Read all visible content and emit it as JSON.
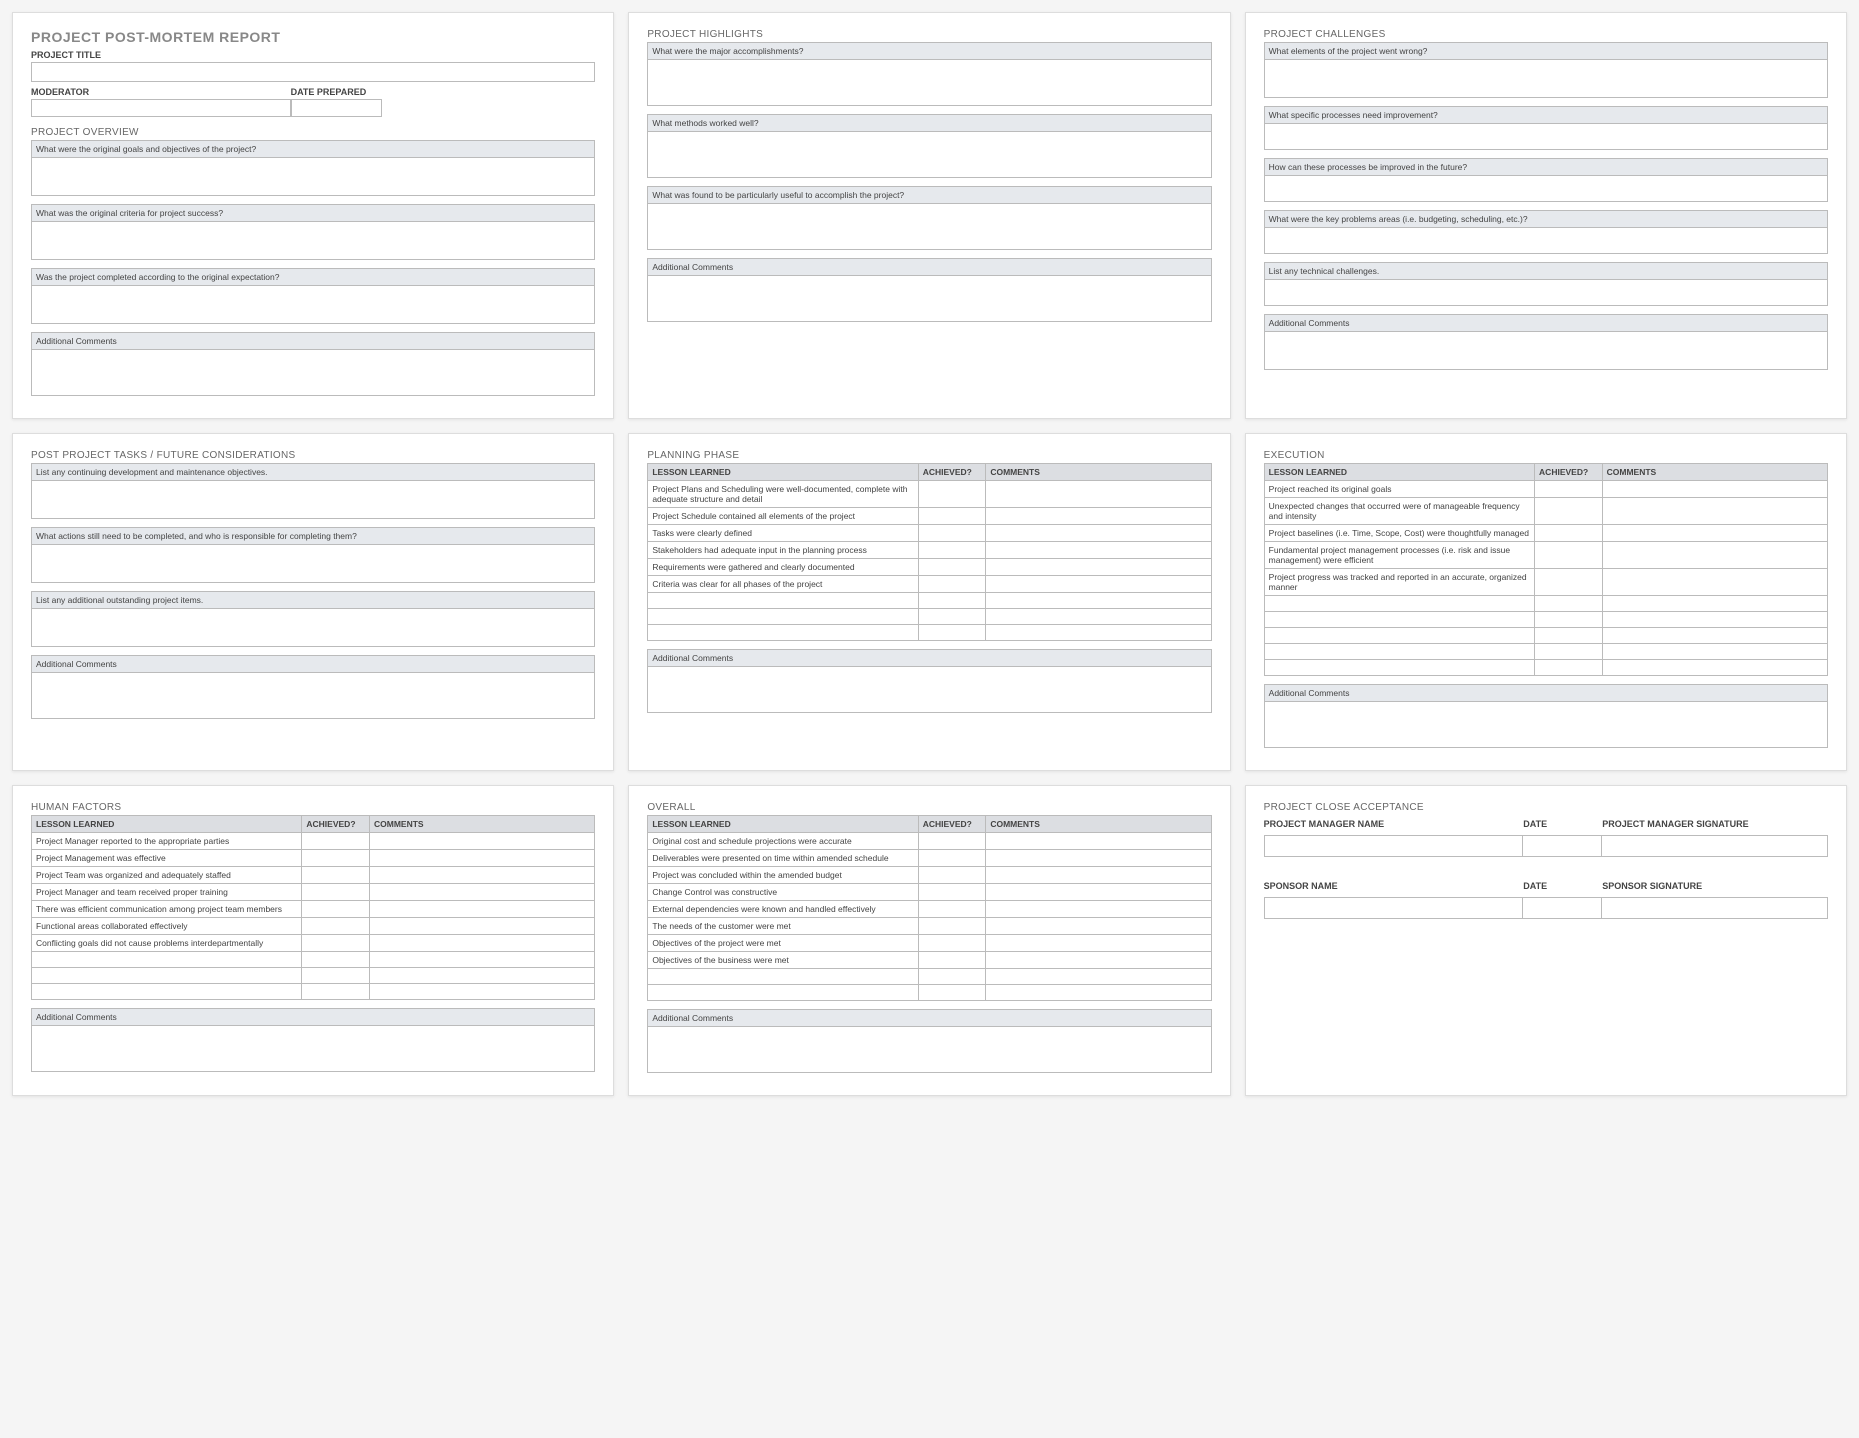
{
  "cards": {
    "1": {
      "title": "PROJECT POST-MORTEM REPORT",
      "projectTitleLabel": "PROJECT TITLE",
      "moderatorLabel": "MODERATOR",
      "datePreparedLabel": "DATE PREPARED",
      "overviewHead": "PROJECT OVERVIEW",
      "q1": "What were the original goals and objectives of the project?",
      "q2": "What was the original criteria for project success?",
      "q3": "Was the project completed according to the original expectation?",
      "addl": "Additional Comments"
    },
    "2": {
      "head": "PROJECT HIGHLIGHTS",
      "q1": "What were the major accomplishments?",
      "q2": "What methods worked well?",
      "q3": "What was found to be particularly useful to accomplish the project?",
      "addl": "Additional Comments"
    },
    "3": {
      "head": "PROJECT CHALLENGES",
      "q1": "What elements of the project went wrong?",
      "q2": "What specific processes need improvement?",
      "q3": "How can these processes be improved in the future?",
      "q4": "What were the key problems areas (i.e. budgeting, scheduling, etc.)?",
      "q5": "List any technical challenges.",
      "addl": "Additional Comments"
    },
    "4": {
      "head": "POST PROJECT TASKS / FUTURE CONSIDERATIONS",
      "q1": "List any continuing development and maintenance objectives.",
      "q2": "What actions still need to be completed, and who is responsible for completing them?",
      "q3": "List any additional outstanding project items.",
      "addl": "Additional Comments"
    },
    "5": {
      "head": "PLANNING PHASE",
      "th1": "LESSON LEARNED",
      "th2": "ACHIEVED?",
      "th3": "COMMENTS",
      "rows": [
        "Project Plans and Scheduling were well-documented, complete with adequate structure and detail",
        "Project Schedule contained all elements of the project",
        "Tasks were clearly defined",
        "Stakeholders had adequate input in the planning process",
        "Requirements were gathered and clearly documented",
        "Criteria was clear for all phases of the project"
      ],
      "addl": "Additional Comments"
    },
    "6": {
      "head": "EXECUTION",
      "th1": "LESSON LEARNED",
      "th2": "ACHIEVED?",
      "th3": "COMMENTS",
      "rows": [
        "Project reached its original goals",
        "Unexpected changes that occurred were of manageable frequency and intensity",
        "Project baselines (i.e. Time, Scope, Cost) were thoughtfully managed",
        "Fundamental project management processes (i.e. risk and issue management) were efficient",
        "Project progress was tracked and reported in an accurate, organized manner"
      ],
      "addl": "Additional Comments"
    },
    "7": {
      "head": "HUMAN FACTORS",
      "th1": "LESSON LEARNED",
      "th2": "ACHIEVED?",
      "th3": "COMMENTS",
      "rows": [
        "Project Manager reported to the appropriate parties",
        "Project Management was effective",
        "Project Team was organized and adequately staffed",
        "Project Manager and team received proper training",
        "There was efficient communication among project team members",
        "Functional areas collaborated effectively",
        "Conflicting goals did not cause problems interdepartmentally"
      ],
      "addl": "Additional Comments"
    },
    "8": {
      "head": "OVERALL",
      "th1": "LESSON LEARNED",
      "th2": "ACHIEVED?",
      "th3": "COMMENTS",
      "rows": [
        "Original cost and schedule projections were accurate",
        "Deliverables were presented on time within amended schedule",
        "Project was concluded within the amended budget",
        "Change Control was constructive",
        "External dependencies were known and handled effectively",
        "The needs of the customer were met",
        "Objectives of the project were met",
        "Objectives of the business were met"
      ],
      "addl": "Additional Comments"
    },
    "9": {
      "head": "PROJECT CLOSE ACCEPTANCE",
      "pmName": "PROJECT MANAGER NAME",
      "date": "DATE",
      "pmSig": "PROJECT MANAGER SIGNATURE",
      "spName": "SPONSOR NAME",
      "spSig": "SPONSOR SIGNATURE"
    }
  }
}
